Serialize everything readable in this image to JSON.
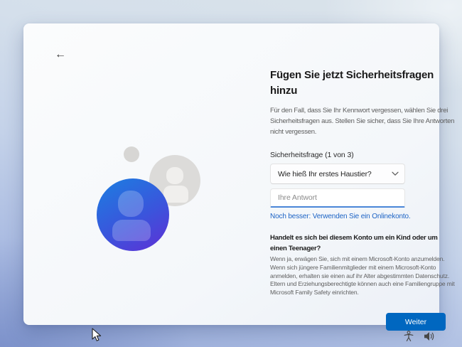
{
  "colors": {
    "accent": "#0067c0",
    "link": "#1c63c5",
    "underline": "#4a86d8",
    "avatar_blue_start": "#2079e0",
    "avatar_blue_mid": "#3a55dc",
    "avatar_blue_end": "#5c33d6"
  },
  "icons": {
    "back": "←"
  },
  "card": {
    "title": "Fügen Sie jetzt Sicherheitsfragen hinzu",
    "subtitle": "Für den Fall, dass Sie Ihr Kennwort vergessen, wählen Sie drei Sicherheitsfragen aus. Stellen Sie sicher, dass Sie Ihre Antworten nicht vergessen.",
    "form": {
      "question_label": "Sicherheitsfrage (1 von 3)",
      "question_selected": "Wie hieß Ihr erstes Haustier?",
      "answer_placeholder": "Ihre Antwort"
    },
    "online_link": "Noch besser: Verwenden Sie ein Onlinekonto.",
    "child_section": {
      "heading": "Handelt es sich bei diesem Konto um ein Kind oder um einen Teenager?",
      "body": "Wenn ja, erwägen Sie, sich mit einem Microsoft-Konto anzumelden. Wenn sich jüngere Familienmitglieder mit einem Microsoft-Konto anmelden, erhalten sie einen auf ihr Alter abgestimmten Datenschutz. Eltern und Erziehungsberechtigte können auch eine Familiengruppe mit Microsoft Family Safety einrichten."
    },
    "next_button": "Weiter"
  }
}
